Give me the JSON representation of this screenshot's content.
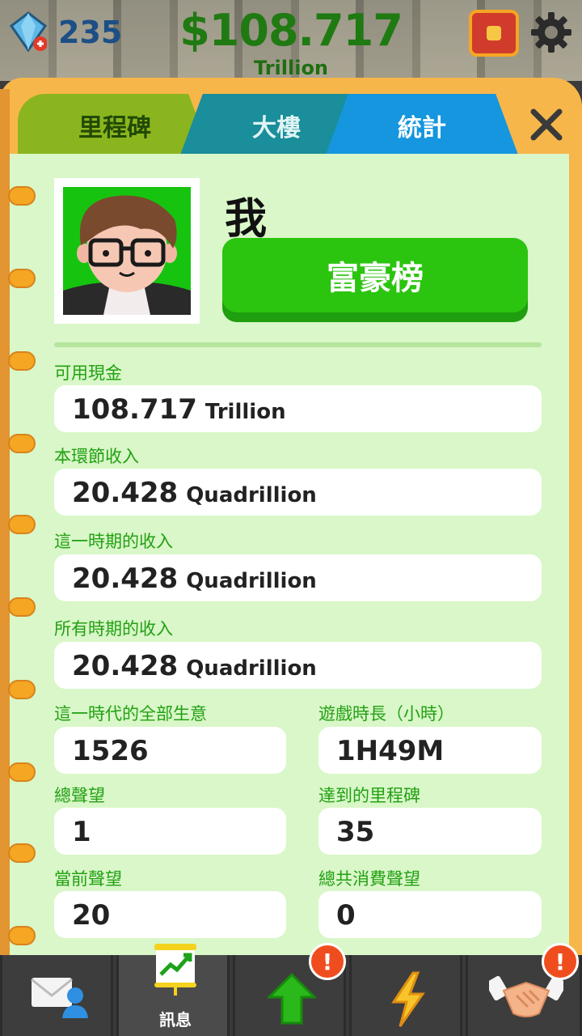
{
  "hud": {
    "gems": "235",
    "cash": "$108.717",
    "cash_unit": "Trillion",
    "icons": [
      "gem-icon",
      "treasure-chest-icon",
      "gear-icon"
    ]
  },
  "tabs": [
    {
      "label": "里程碑"
    },
    {
      "label": "大樓"
    },
    {
      "label": "統計",
      "active": true
    }
  ],
  "profile": {
    "name": "我",
    "leaderboard_button": "富豪榜"
  },
  "stats": {
    "cash": {
      "label": "可用現金",
      "value": "108.717",
      "unit": "Trillion"
    },
    "loop_income": {
      "label": "本環節收入",
      "value": "20.428",
      "unit": "Quadrillion"
    },
    "period_income": {
      "label": "這一時期的收入",
      "value": "20.428",
      "unit": "Quadrillion"
    },
    "all_time_income": {
      "label": "所有時期的收入",
      "value": "20.428",
      "unit": "Quadrillion"
    },
    "businesses": {
      "label": "這一時代的全部生意",
      "value": "1526"
    },
    "play_time": {
      "label": "遊戲時長（小時）",
      "value": "1H49M"
    },
    "total_prestige": {
      "label": "總聲望",
      "value": "1"
    },
    "milestones_reached": {
      "label": "達到的里程碑",
      "value": "35"
    },
    "current_prestige": {
      "label": "當前聲望",
      "value": "20"
    },
    "prestige_spent": {
      "label": "總共消費聲望",
      "value": "0"
    }
  },
  "navbar": {
    "items": [
      {
        "icon": "mail-contact-icon"
      },
      {
        "icon": "chart-board-icon",
        "label": "訊息",
        "active": true
      },
      {
        "icon": "green-arrow-up-icon",
        "alert": "!"
      },
      {
        "icon": "lightning-icon"
      },
      {
        "icon": "handshake-icon",
        "alert": "!"
      }
    ]
  },
  "colors": {
    "panel_bg": "#d9f7c8",
    "label_green": "#22a013",
    "button_green": "#2bc40f",
    "tab_active": "#1596de",
    "alert": "#f04d1e"
  }
}
